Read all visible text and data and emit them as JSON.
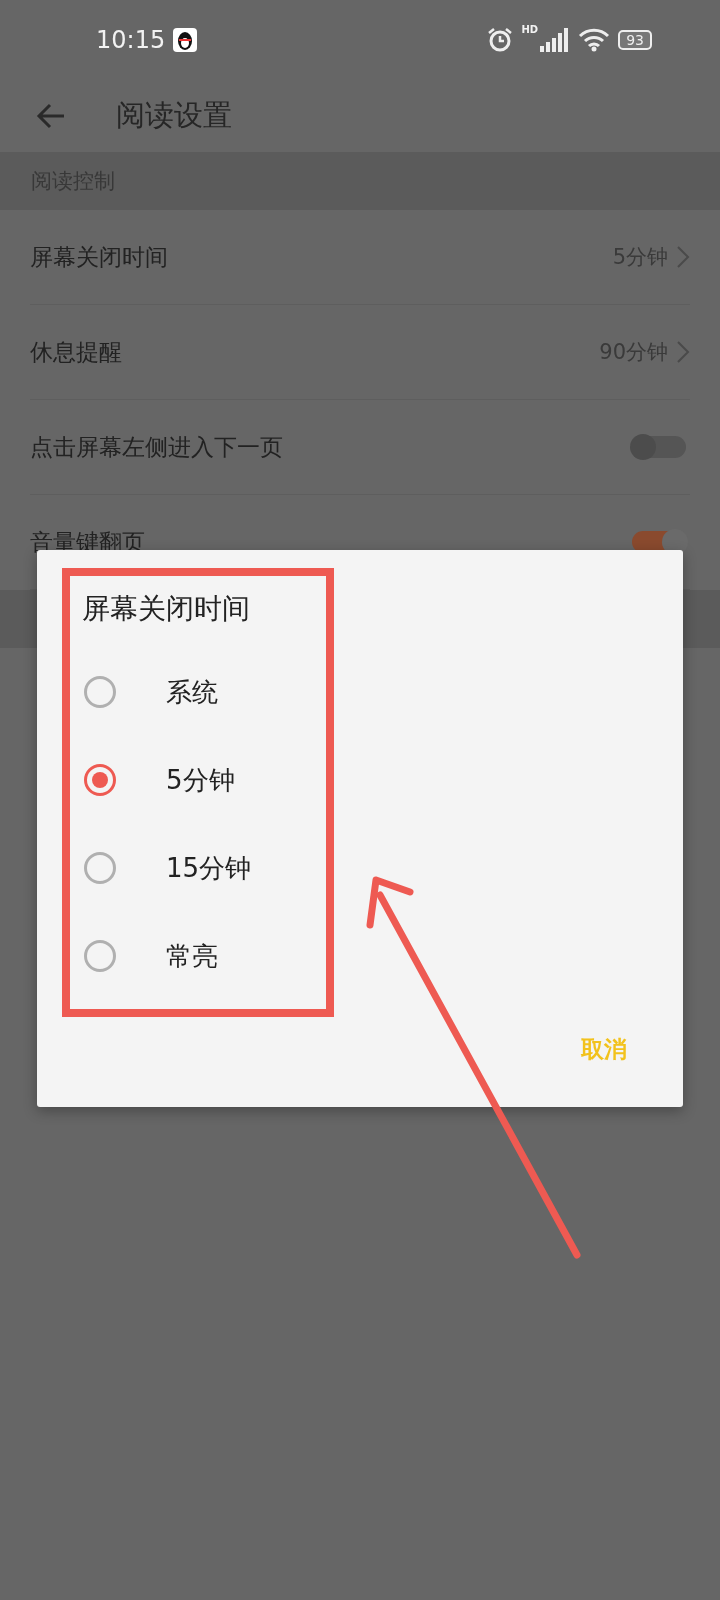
{
  "status_bar": {
    "time": "10:15",
    "network": "HD",
    "battery": "93"
  },
  "header": {
    "title": "阅读设置"
  },
  "section": {
    "title": "阅读控制",
    "items": [
      {
        "kind": "link",
        "label": "屏幕关闭时间",
        "value": "5分钟"
      },
      {
        "kind": "link",
        "label": "休息提醒",
        "value": "90分钟"
      },
      {
        "kind": "toggle",
        "label": "点击屏幕左侧进入下一页",
        "on": false
      },
      {
        "kind": "toggle",
        "label": "音量键翻页",
        "on": true
      }
    ]
  },
  "dialog": {
    "title": "屏幕关闭时间",
    "options": [
      {
        "label": "系统",
        "selected": false
      },
      {
        "label": "5分钟",
        "selected": true
      },
      {
        "label": "15分钟",
        "selected": false
      },
      {
        "label": "常亮",
        "selected": false
      }
    ],
    "cancel": "取消"
  }
}
